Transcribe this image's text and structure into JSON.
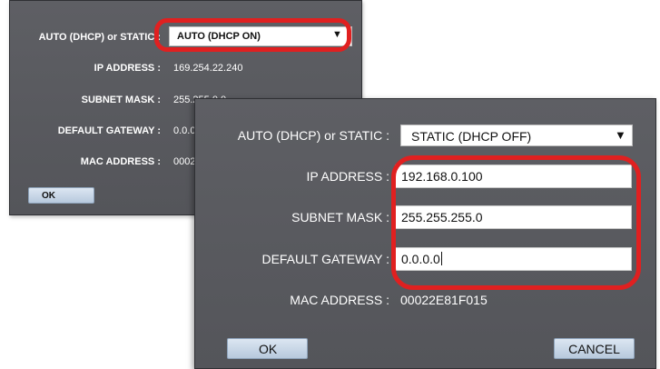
{
  "back_dialog": {
    "mode_label": "AUTO (DHCP) or STATIC :",
    "mode_value": "AUTO (DHCP ON)",
    "ip_label": "IP ADDRESS :",
    "ip_value": "169.254.22.240",
    "mask_label": "SUBNET MASK :",
    "mask_value": "255.255.0.0",
    "gateway_label": "DEFAULT GATEWAY :",
    "gateway_value": "0.0.0.0",
    "mac_label": "MAC ADDRESS :",
    "mac_value": "00022E81F015",
    "ok_label": "OK"
  },
  "front_dialog": {
    "mode_label": "AUTO (DHCP) or STATIC :",
    "mode_value": "STATIC (DHCP OFF)",
    "ip_label": "IP ADDRESS :",
    "ip_value": "192.168.0.100",
    "mask_label": "SUBNET MASK :",
    "mask_value": "255.255.255.0",
    "gateway_label": "DEFAULT GATEWAY :",
    "gateway_value": "0.0.0.0",
    "mac_label": "MAC ADDRESS :",
    "mac_value": "00022E81F015",
    "ok_label": "OK",
    "cancel_label": "CANCEL"
  },
  "icons": {
    "dropdown_arrow": "▼"
  },
  "colors": {
    "dialog_bg": "#5a5b60",
    "highlight": "#e02020",
    "button": "#c8d6e6"
  }
}
